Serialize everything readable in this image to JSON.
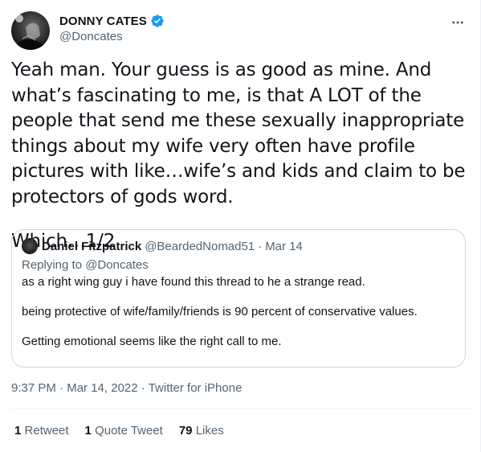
{
  "author": {
    "display_name": "DONNY CATES",
    "handle": "@Doncates",
    "verified": true,
    "verified_color": "#1d9bf0"
  },
  "tweet": {
    "line1": "Yeah man. Your guess is as good as mine. And what’s fascinating to me, is that A LOT of the people that send me these sexually inappropriate things about my wife very often have profile pictures with like…wife’s and kids and claim to be protectors of gods word.",
    "line2": "Which…1/2"
  },
  "quoted": {
    "name": "Daniel Fitzpatrick",
    "handle": "@BeardedNomad51",
    "dot": "·",
    "date": "Mar 14",
    "replying_prefix": "Replying to",
    "replying_to": "@Doncates",
    "paragraphs": [
      "as a right wing guy i have found this thread to he a strange read.",
      "being protective of wife/family/friends is 90 percent of conservative values.",
      "Getting emotional seems like the right call to me."
    ]
  },
  "meta": {
    "time": "9:37 PM",
    "dot1": "·",
    "date": "Mar 14, 2022",
    "dot2": "·",
    "source": "Twitter for iPhone"
  },
  "stats": {
    "retweets_count": "1",
    "retweets_label": "Retweet",
    "quotes_count": "1",
    "quotes_label": "Quote Tweet",
    "likes_count": "79",
    "likes_label": "Likes"
  },
  "icons": {
    "more": "more-horizontal-icon",
    "verified": "verified-badge-icon"
  }
}
